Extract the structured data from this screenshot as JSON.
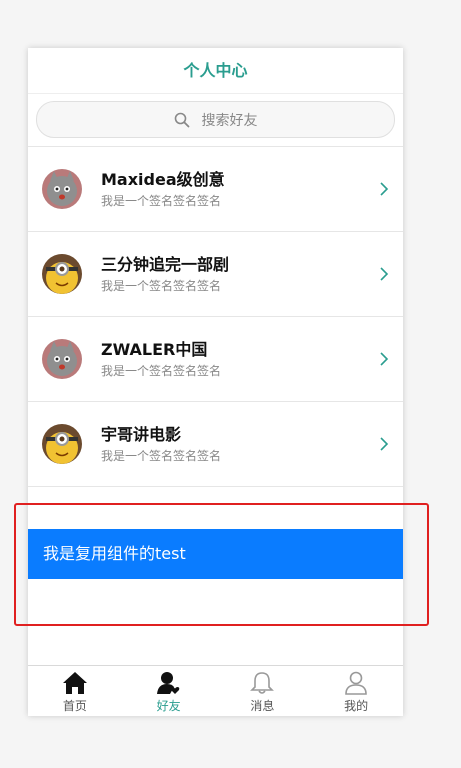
{
  "header": {
    "title": "个人中心"
  },
  "search": {
    "placeholder": "搜索好友"
  },
  "friends": [
    {
      "name": "Maxidea级创意",
      "signature": "我是一个签名签名签名",
      "avatar": "cat-avatar"
    },
    {
      "name": "三分钟追完一部剧",
      "signature": "我是一个签名签名签名",
      "avatar": "minion-avatar"
    },
    {
      "name": "ZWALER中国",
      "signature": "我是一个签名签名签名",
      "avatar": "cat-avatar"
    },
    {
      "name": "宇哥讲电影",
      "signature": "我是一个签名签名签名",
      "avatar": "minion-avatar"
    }
  ],
  "component_test": {
    "text": "我是复用组件的test"
  },
  "tabbar": {
    "tabs": [
      {
        "label": "首页",
        "icon": "home-icon",
        "active": false
      },
      {
        "label": "好友",
        "icon": "friend-icon",
        "active": true
      },
      {
        "label": "消息",
        "icon": "bell-icon",
        "active": false
      },
      {
        "label": "我的",
        "icon": "user-icon",
        "active": false
      }
    ]
  },
  "colors": {
    "accent": "#2a9d8f",
    "component_bg": "#0a7cff",
    "highlight": "#e02020"
  }
}
